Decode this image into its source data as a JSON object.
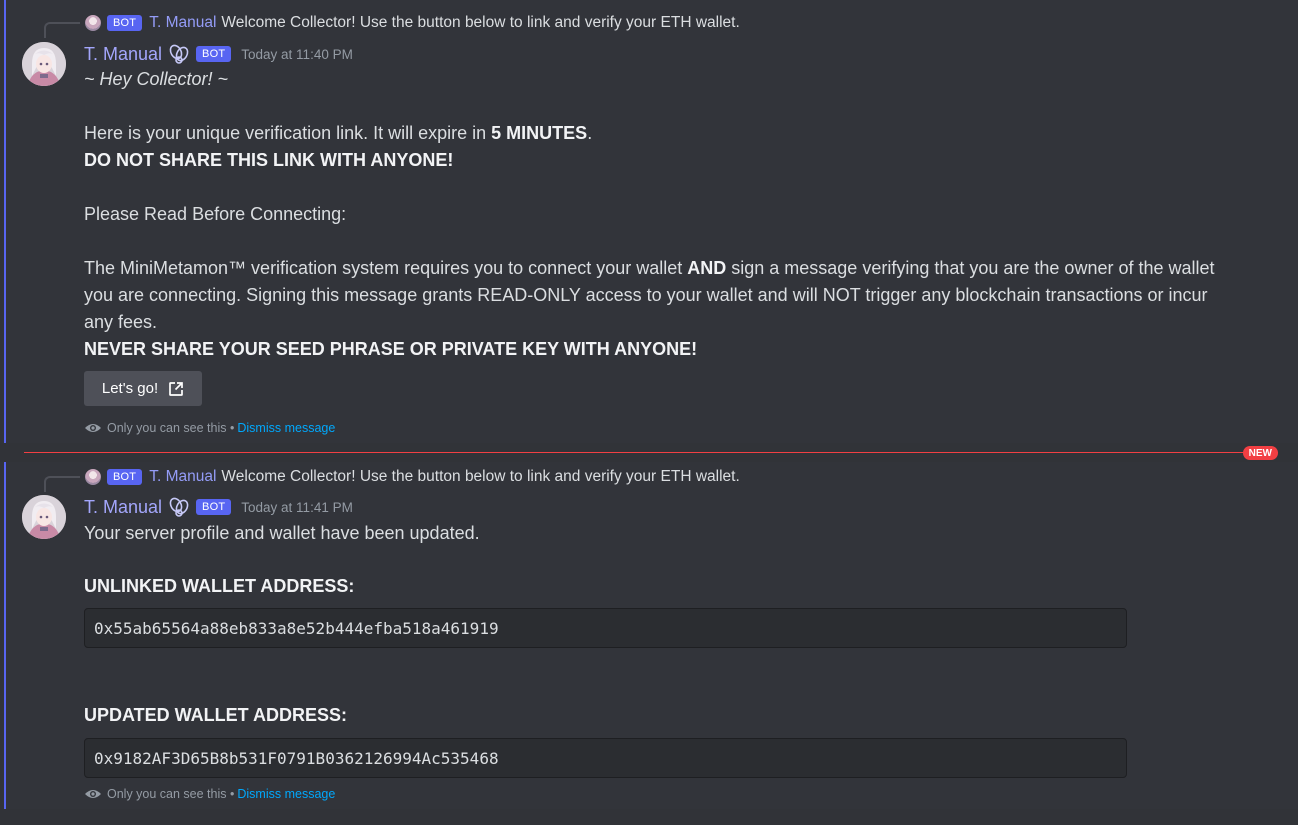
{
  "messages": [
    {
      "reply": {
        "bot_tag": "BOT",
        "name": "T. Manual",
        "text": "Welcome Collector! Use the button below to link and verify your ETH wallet."
      },
      "author": "T. Manual",
      "bot_tag": "BOT",
      "timestamp": "Today at 11:40 PM",
      "greeting": "~ Hey Collector! ~",
      "line1_pre": "Here is your unique verification link. It will expire in ",
      "line1_bold": "5 MINUTES",
      "line1_post": ".",
      "warning1": "DO NOT SHARE THIS LINK WITH ANYONE!",
      "read_before": "Please Read Before Connecting:",
      "para_pre": "The MiniMetamon™ verification system requires you to connect your wallet ",
      "para_bold": "AND",
      "para_post": " sign a message verifying that you are the owner of the wallet you are connecting. Signing this message grants READ-ONLY access to your wallet and will NOT trigger any blockchain transactions or incur any fees.",
      "warning2": "NEVER SHARE YOUR SEED PHRASE OR PRIVATE KEY WITH ANYONE!",
      "button_label": "Let's go!",
      "ephemeral_text": "Only you can see this •",
      "dismiss_label": "Dismiss message"
    },
    {
      "reply": {
        "bot_tag": "BOT",
        "name": "T. Manual",
        "text": "Welcome Collector! Use the button below to link and verify your ETH wallet."
      },
      "author": "T. Manual",
      "bot_tag": "BOT",
      "timestamp": "Today at 11:41 PM",
      "updated_text": "Your server profile and wallet have been updated.",
      "unlinked_title": "UNLINKED WALLET ADDRESS:",
      "unlinked_address": "0x55ab65564a88eb833a8e52b444efba518a461919",
      "updated_title": "UPDATED WALLET ADDRESS:",
      "updated_address": "0x9182AF3D65B8b531F0791B0362126994Ac535468",
      "ephemeral_text": "Only you can see this •",
      "dismiss_label": "Dismiss message"
    }
  ],
  "new_badge": "NEW",
  "icons": {
    "avatar": "anime-girl-avatar",
    "role": "role-badge-icon",
    "external_link": "external-link-icon",
    "eye": "eye-icon"
  },
  "colors": {
    "background": "#313338",
    "accent": "#5865f2",
    "username": "#a3a6fb",
    "link": "#00a8fc",
    "new_divider": "#f23f43"
  }
}
